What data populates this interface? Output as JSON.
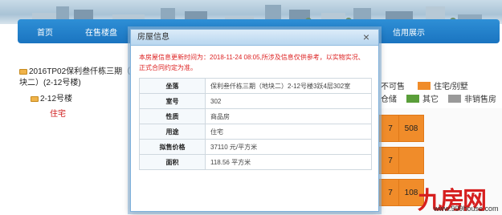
{
  "nav": {
    "items": [
      "首页",
      "在售楼盘",
      "",
      "",
      "",
      "",
      "信用展示"
    ]
  },
  "tree": {
    "root_label": "2016TP02保利叁仟栋三期（地块二）(2-12号楼)",
    "child_label": "2-12号楼",
    "leaf_label": "住宅"
  },
  "legend": {
    "row1": [
      {
        "label": "不可售",
        "color": "#ffffff"
      },
      {
        "label": "住宅/别墅",
        "color": "#f08c2a"
      }
    ],
    "row2": [
      {
        "label": "仓储",
        "color": "#ffffff"
      },
      {
        "label": "其它",
        "color": "#5a9e3a"
      },
      {
        "label": "非销售房",
        "color": "#9a9a9a"
      }
    ]
  },
  "grid": {
    "cells": [
      "7",
      "508",
      "7",
      "",
      "7",
      "108"
    ]
  },
  "dialog": {
    "title": "房屋信息",
    "close_glyph": "×",
    "notice": "本房屋信息更新时间为：2018-11-24 08:05,所涉及信息仅供参考，以实物实况、正式合同约定为准。",
    "rows": [
      {
        "key": "坐落",
        "value": "保利叁仟栋三期（地块二）2-12号楼3跃4层302室"
      },
      {
        "key": "室号",
        "value": "302"
      },
      {
        "key": "性质",
        "value": "商品房"
      },
      {
        "key": "用途",
        "value": "住宅"
      },
      {
        "key": "拟售价格",
        "value": "37110 元/平方米"
      },
      {
        "key": "面积",
        "value": "118.56 平方米"
      }
    ]
  },
  "watermark": {
    "logo": "九房网",
    "url": "www.999house.com"
  }
}
